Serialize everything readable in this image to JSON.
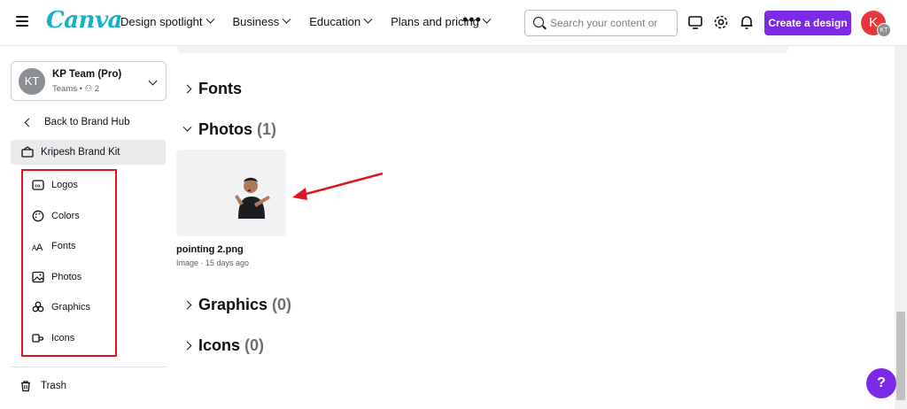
{
  "app": {
    "logo": "Canva"
  },
  "nav": {
    "items": [
      {
        "label": "Design spotlight"
      },
      {
        "label": "Business"
      },
      {
        "label": "Education"
      },
      {
        "label": "Plans and pricing"
      }
    ],
    "more_label": "•••"
  },
  "search": {
    "placeholder": "Search your content or"
  },
  "header": {
    "create_label": "Create a design",
    "avatar_initial": "K",
    "avatar_badge": "KT"
  },
  "sidebar": {
    "team": {
      "initials": "KT",
      "name": "KP Team (Pro)",
      "sub": "Teams • ⚇ 2"
    },
    "back_label": "Back to Brand Hub",
    "kit_label": "Kripesh Brand Kit",
    "items": [
      {
        "label": "Logos"
      },
      {
        "label": "Colors"
      },
      {
        "label": "Fonts"
      },
      {
        "label": "Photos"
      },
      {
        "label": "Graphics"
      },
      {
        "label": "Icons"
      }
    ],
    "trash_label": "Trash"
  },
  "main": {
    "sections": [
      {
        "title": "Fonts",
        "count": ""
      },
      {
        "title": "Photos",
        "count": "(1)"
      },
      {
        "title": "Graphics",
        "count": "(0)"
      },
      {
        "title": "Icons",
        "count": "(0)"
      }
    ],
    "photo": {
      "name": "pointing 2.png",
      "meta": "Image · 15 days ago"
    }
  },
  "help_label": "?",
  "colors": {
    "brand": "#7d2ae8",
    "logo": "#18b0c6",
    "annotation": "#e0141e",
    "avatar": "#e8363b"
  }
}
